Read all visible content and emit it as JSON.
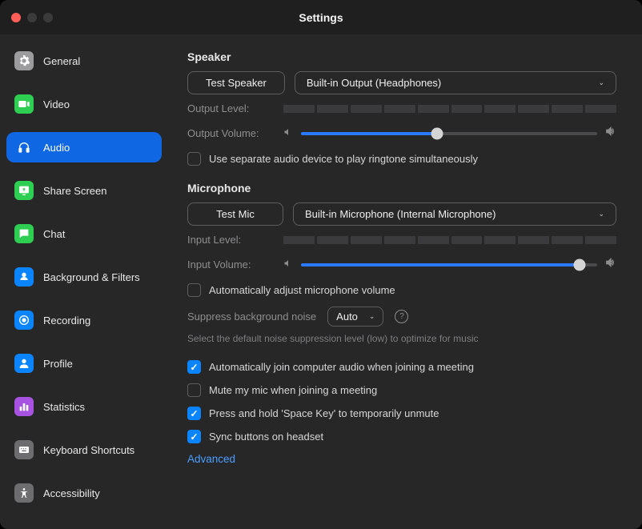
{
  "window": {
    "title": "Settings"
  },
  "sidebar": {
    "items": [
      {
        "id": "general",
        "label": "General"
      },
      {
        "id": "video",
        "label": "Video"
      },
      {
        "id": "audio",
        "label": "Audio"
      },
      {
        "id": "share",
        "label": "Share Screen"
      },
      {
        "id": "chat",
        "label": "Chat"
      },
      {
        "id": "filters",
        "label": "Background & Filters"
      },
      {
        "id": "recording",
        "label": "Recording"
      },
      {
        "id": "profile",
        "label": "Profile"
      },
      {
        "id": "stats",
        "label": "Statistics"
      },
      {
        "id": "keyboard",
        "label": "Keyboard Shortcuts"
      },
      {
        "id": "access",
        "label": "Accessibility"
      }
    ],
    "active": "audio"
  },
  "speaker": {
    "title": "Speaker",
    "test_btn": "Test Speaker",
    "selected": "Built-in Output (Headphones)",
    "output_level_label": "Output Level:",
    "output_volume_label": "Output Volume:",
    "output_volume_pct": 46,
    "ringtone_checkbox": "Use separate audio device to play ringtone simultaneously",
    "ringtone_checked": false
  },
  "mic": {
    "title": "Microphone",
    "test_btn": "Test Mic",
    "selected": "Built-in Microphone (Internal Microphone)",
    "input_level_label": "Input Level:",
    "input_volume_label": "Input Volume:",
    "input_volume_pct": 94,
    "auto_adjust": "Automatically adjust microphone volume",
    "auto_adjust_checked": false,
    "noise_label": "Suppress background noise",
    "noise_value": "Auto",
    "noise_hint": "Select the default noise suppression level (low) to optimize for music"
  },
  "other": {
    "auto_join": "Automatically join computer audio when joining a meeting",
    "auto_join_checked": true,
    "mute_on_join": "Mute my mic when joining a meeting",
    "mute_on_join_checked": false,
    "hold_space": "Press and hold 'Space Key' to temporarily unmute",
    "hold_space_checked": true,
    "sync_headset": "Sync buttons on headset",
    "sync_headset_checked": true,
    "advanced": "Advanced"
  }
}
